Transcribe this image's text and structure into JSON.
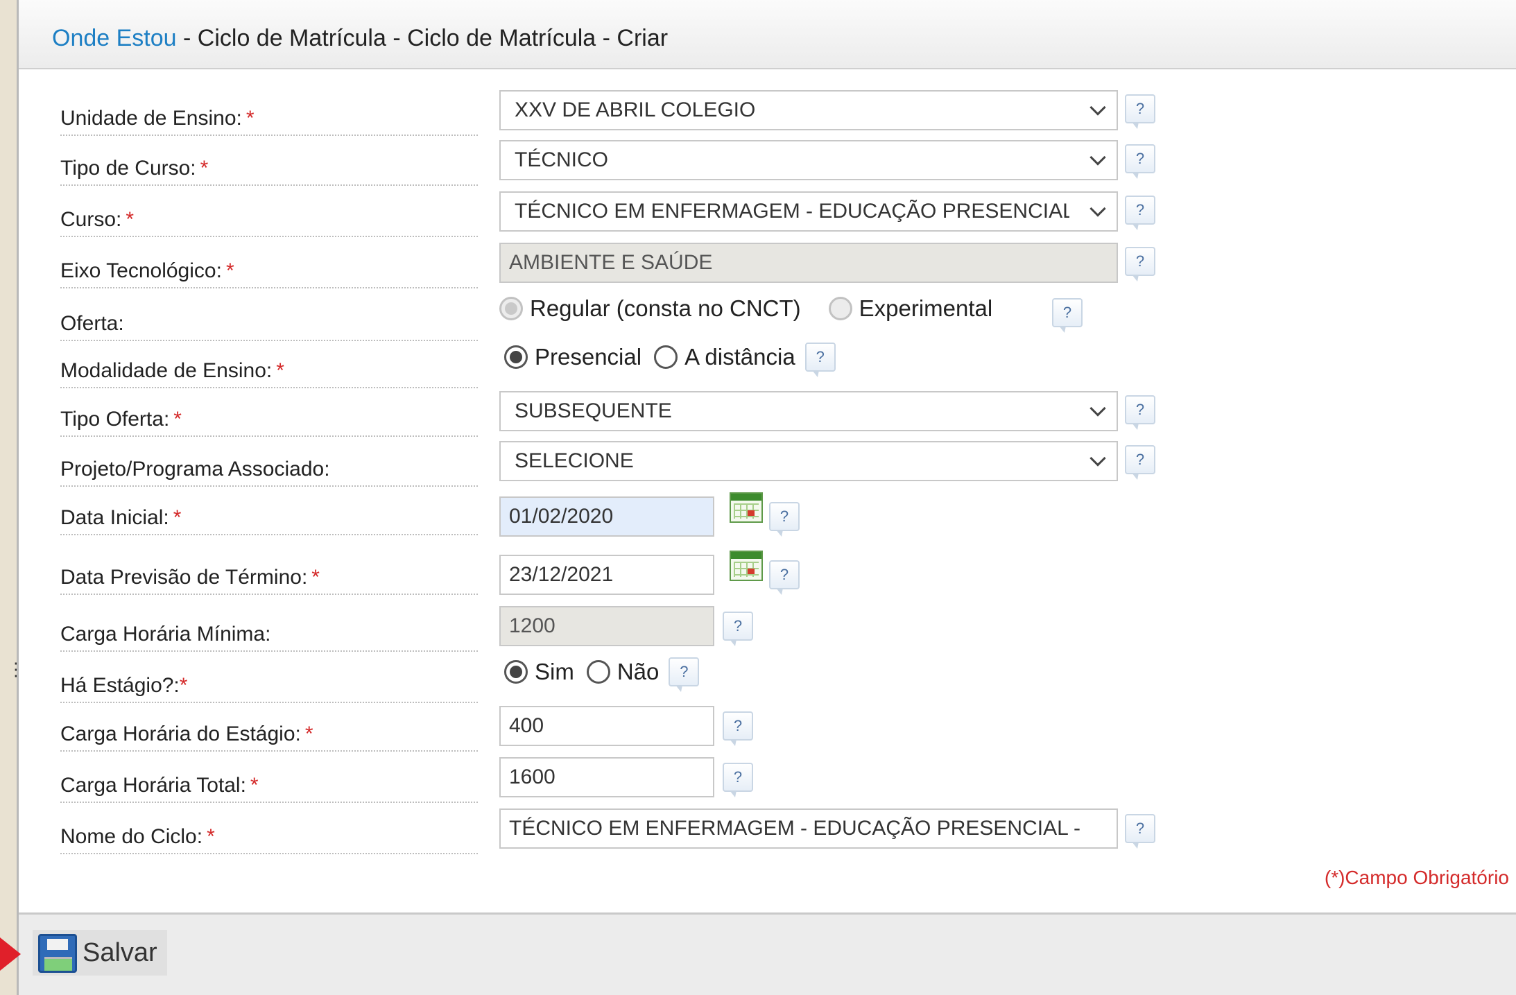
{
  "breadcrumb": {
    "here": "Onde Estou",
    "path": " - Ciclo de Matrícula - Ciclo de Matrícula - Criar"
  },
  "required_mark": "*",
  "help_label": "?",
  "form": {
    "unidade": {
      "label": "Unidade de Ensino:",
      "value": "XXV DE ABRIL COLEGIO"
    },
    "tipo_curso": {
      "label": "Tipo de Curso:",
      "value": "TÉCNICO"
    },
    "curso": {
      "label": "Curso:",
      "value": "TÉCNICO EM ENFERMAGEM - EDUCAÇÃO PRESENCIAL"
    },
    "eixo": {
      "label": "Eixo Tecnológico:",
      "value": "AMBIENTE E SAÚDE"
    },
    "oferta": {
      "label": "Oferta:",
      "options": [
        "Regular (consta no CNCT)",
        "Experimental"
      ]
    },
    "modalidade": {
      "label": "Modalidade de Ensino:",
      "options": [
        "Presencial",
        "A distância"
      ]
    },
    "tipo_oferta": {
      "label": "Tipo Oferta:",
      "value": "SUBSEQUENTE"
    },
    "projeto": {
      "label": "Projeto/Programa Associado:",
      "value": "SELECIONE"
    },
    "data_inicial": {
      "label": "Data Inicial:",
      "value": "01/02/2020"
    },
    "data_termino": {
      "label": "Data Previsão de Término:",
      "value": "23/12/2021"
    },
    "carga_minima": {
      "label": "Carga Horária Mínima:",
      "value": "1200"
    },
    "estagio": {
      "label": "Há Estágio?:",
      "options": [
        "Sim",
        "Não"
      ]
    },
    "carga_estagio": {
      "label": "Carga Horária do Estágio:",
      "value": "400"
    },
    "carga_total": {
      "label": "Carga Horária Total:",
      "value": "1600"
    },
    "nome_ciclo": {
      "label": "Nome do Ciclo:",
      "value": "TÉCNICO EM ENFERMAGEM - EDUCAÇÃO PRESENCIAL - "
    }
  },
  "required_note": "(*)Campo Obrigatório",
  "save_label": "Salvar"
}
